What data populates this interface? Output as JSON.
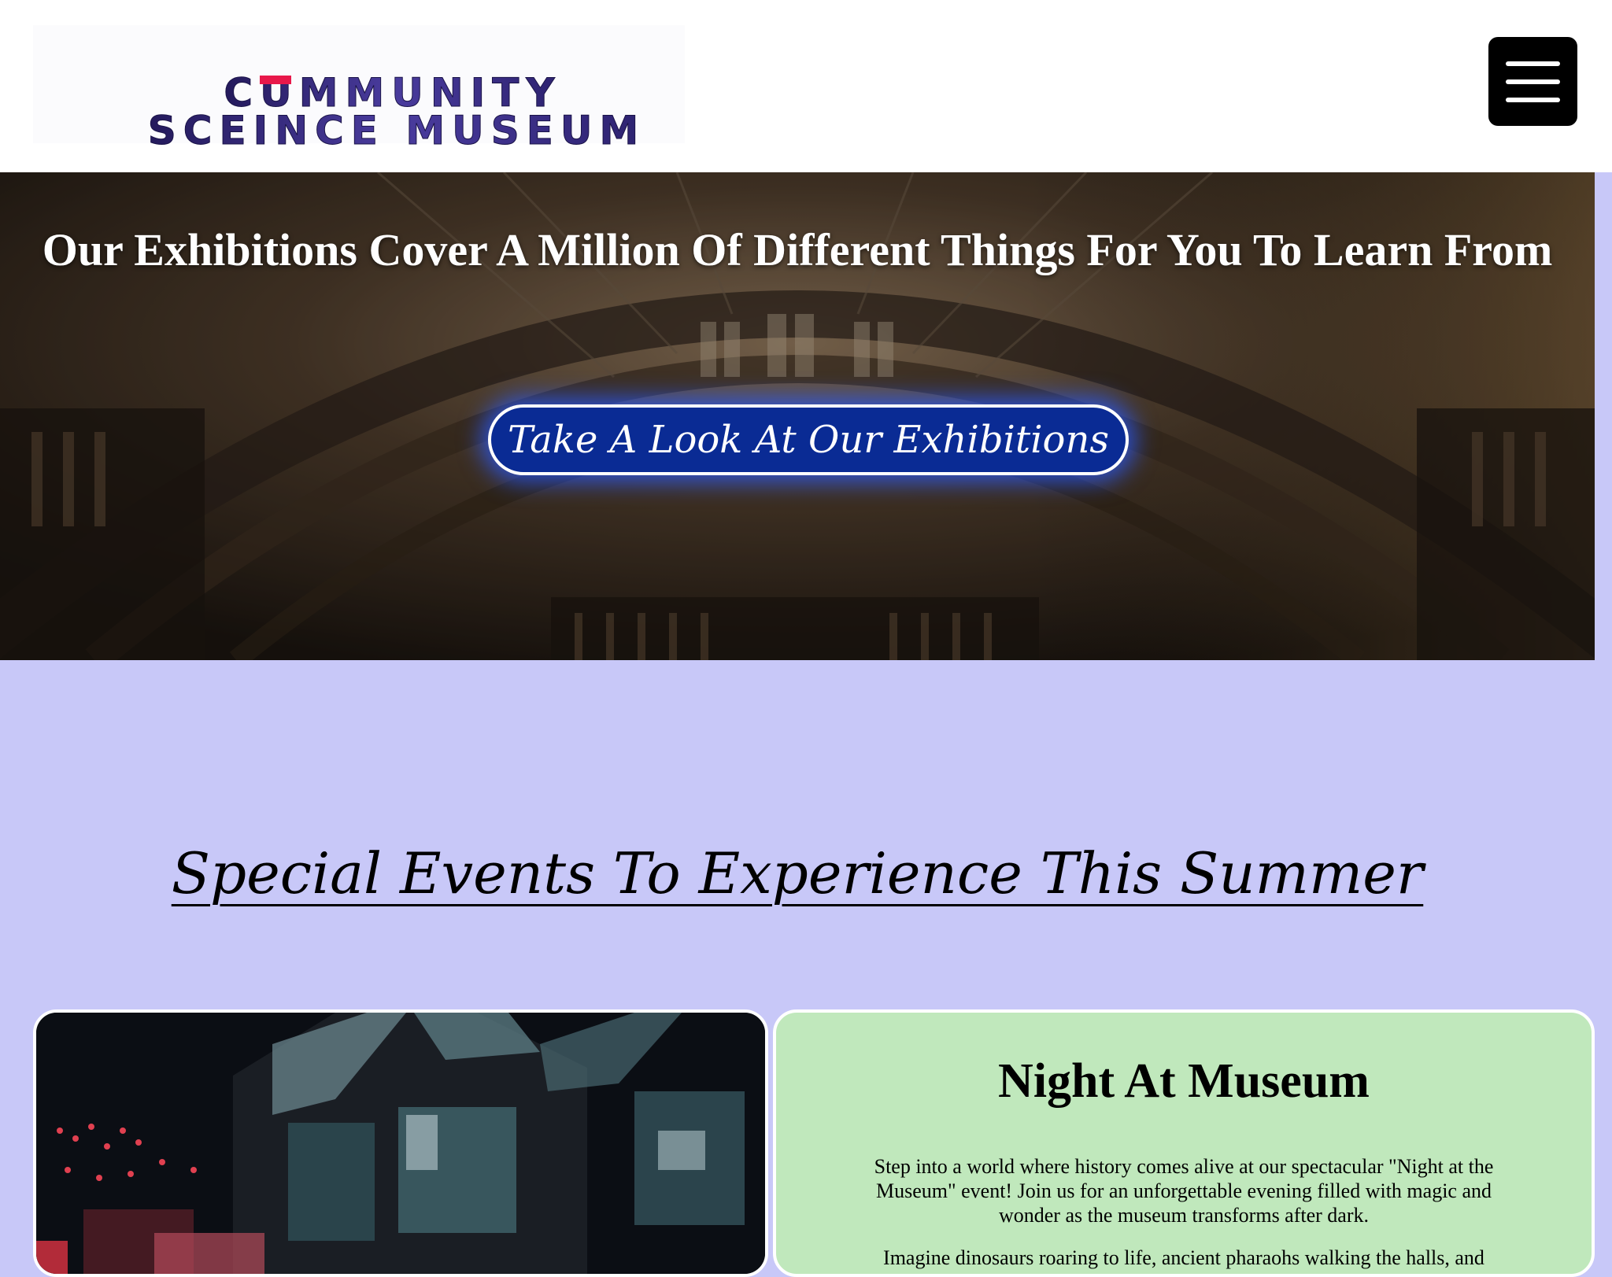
{
  "header": {
    "logo_line1": "CUMMUNITY",
    "logo_line2": "SCEINCE MUSEUM",
    "menu_icon": "hamburger-menu-icon"
  },
  "hero": {
    "title": "Our Exhibitions Cover A Million Of Different Things For You To Learn From",
    "cta_label": "Take A Look At Our Exhibitions"
  },
  "events": {
    "section_title": "Special Events To Experience This Summer",
    "cards": [
      {
        "title": "Night At Museum",
        "paragraph1": "Step into a world where history comes alive at our spectacular \"Night at the Museum\" event! Join us for an unforgettable evening filled with magic and wonder as the museum transforms after dark.",
        "paragraph2": "Imagine dinosaurs roaring to life, ancient pharaohs walking the halls, and"
      }
    ]
  },
  "colors": {
    "page_background": "#c8c8f8",
    "header_background": "#ffffff",
    "logo_gradient_start": "#2a1f66",
    "logo_gradient_end": "#7b6fd0",
    "logo_accent": "#e8184a",
    "cta_background": "#0a2b94",
    "cta_glow": "#285aff",
    "event_card_background": "#c0e8bc"
  }
}
